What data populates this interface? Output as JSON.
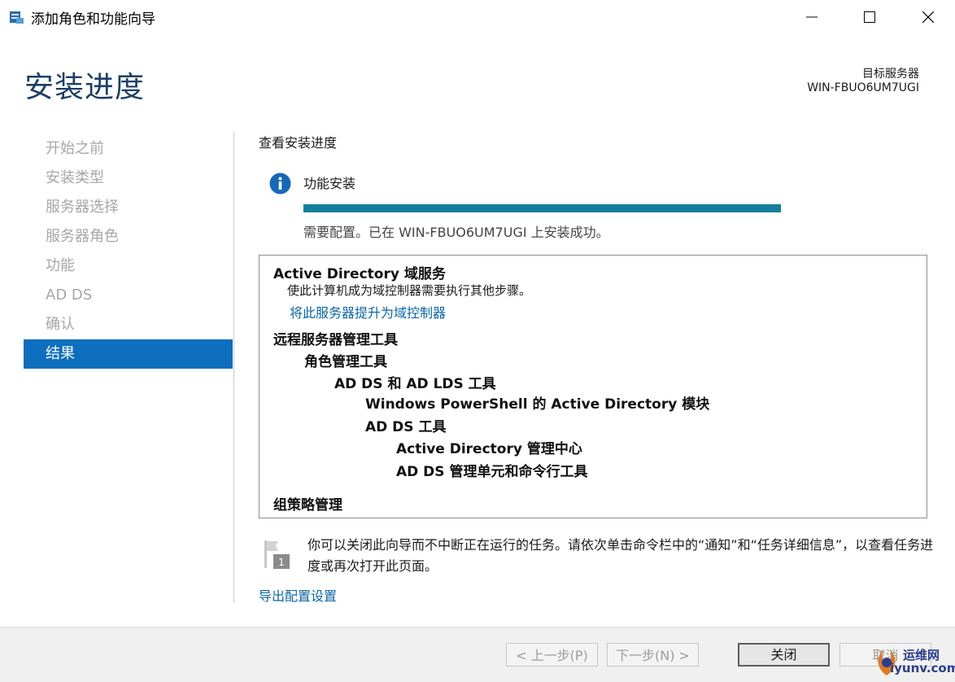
{
  "window": {
    "title": "添加角色和功能向导",
    "icon": "server-manager-icon",
    "minimize_icon": "minimize-icon",
    "maximize_icon": "maximize-icon",
    "close_icon": "close-icon"
  },
  "header": {
    "page_title": "安装进度",
    "target_label": "目标服务器",
    "target_name": "WIN-FBUO6UM7UGI"
  },
  "nav": {
    "items": [
      {
        "label": "开始之前",
        "active": false
      },
      {
        "label": "安装类型",
        "active": false
      },
      {
        "label": "服务器选择",
        "active": false
      },
      {
        "label": "服务器角色",
        "active": false
      },
      {
        "label": "功能",
        "active": false
      },
      {
        "label": "AD DS",
        "active": false
      },
      {
        "label": "确认",
        "active": false
      },
      {
        "label": "结果",
        "active": true
      }
    ]
  },
  "main": {
    "heading": "查看安装进度",
    "feature_label": "功能安装",
    "progress_fraction": 1.0,
    "status": "需要配置。已在 WIN-FBUO6UM7UGI 上安装成功。",
    "results": {
      "ad_title": "Active Directory 域服务",
      "ad_desc": "使此计算机成为域控制器需要执行其他步骤。",
      "ad_link": "将此服务器提升为域控制器",
      "rsat": "远程服务器管理工具",
      "role_tools": "角色管理工具",
      "adds_lds": "AD DS 和 AD LDS 工具",
      "ps_module": "Windows PowerShell 的 Active Directory 模块",
      "adds_tools": "AD DS 工具",
      "admin_center": "Active Directory 管理中心",
      "snapins": "AD DS 管理单元和命令行工具",
      "gpm": "组策略管理"
    },
    "note": "你可以关闭此向导而不中断正在运行的任务。请依次单击命令栏中的“通知”和“任务详细信息”，以查看任务进度或再次打开此页面。",
    "export_link": "导出配置设置"
  },
  "footer": {
    "prev": "< 上一步(P)",
    "next": "下一步(N) >",
    "close": "关闭",
    "cancel": "取消"
  },
  "watermark": {
    "line1": "运维网",
    "line2": "iyunv.com"
  },
  "colors": {
    "title_blue": "#1b3f66",
    "nav_active": "#0d6fbd",
    "progress": "#147e9c",
    "link": "#0a66a6"
  }
}
